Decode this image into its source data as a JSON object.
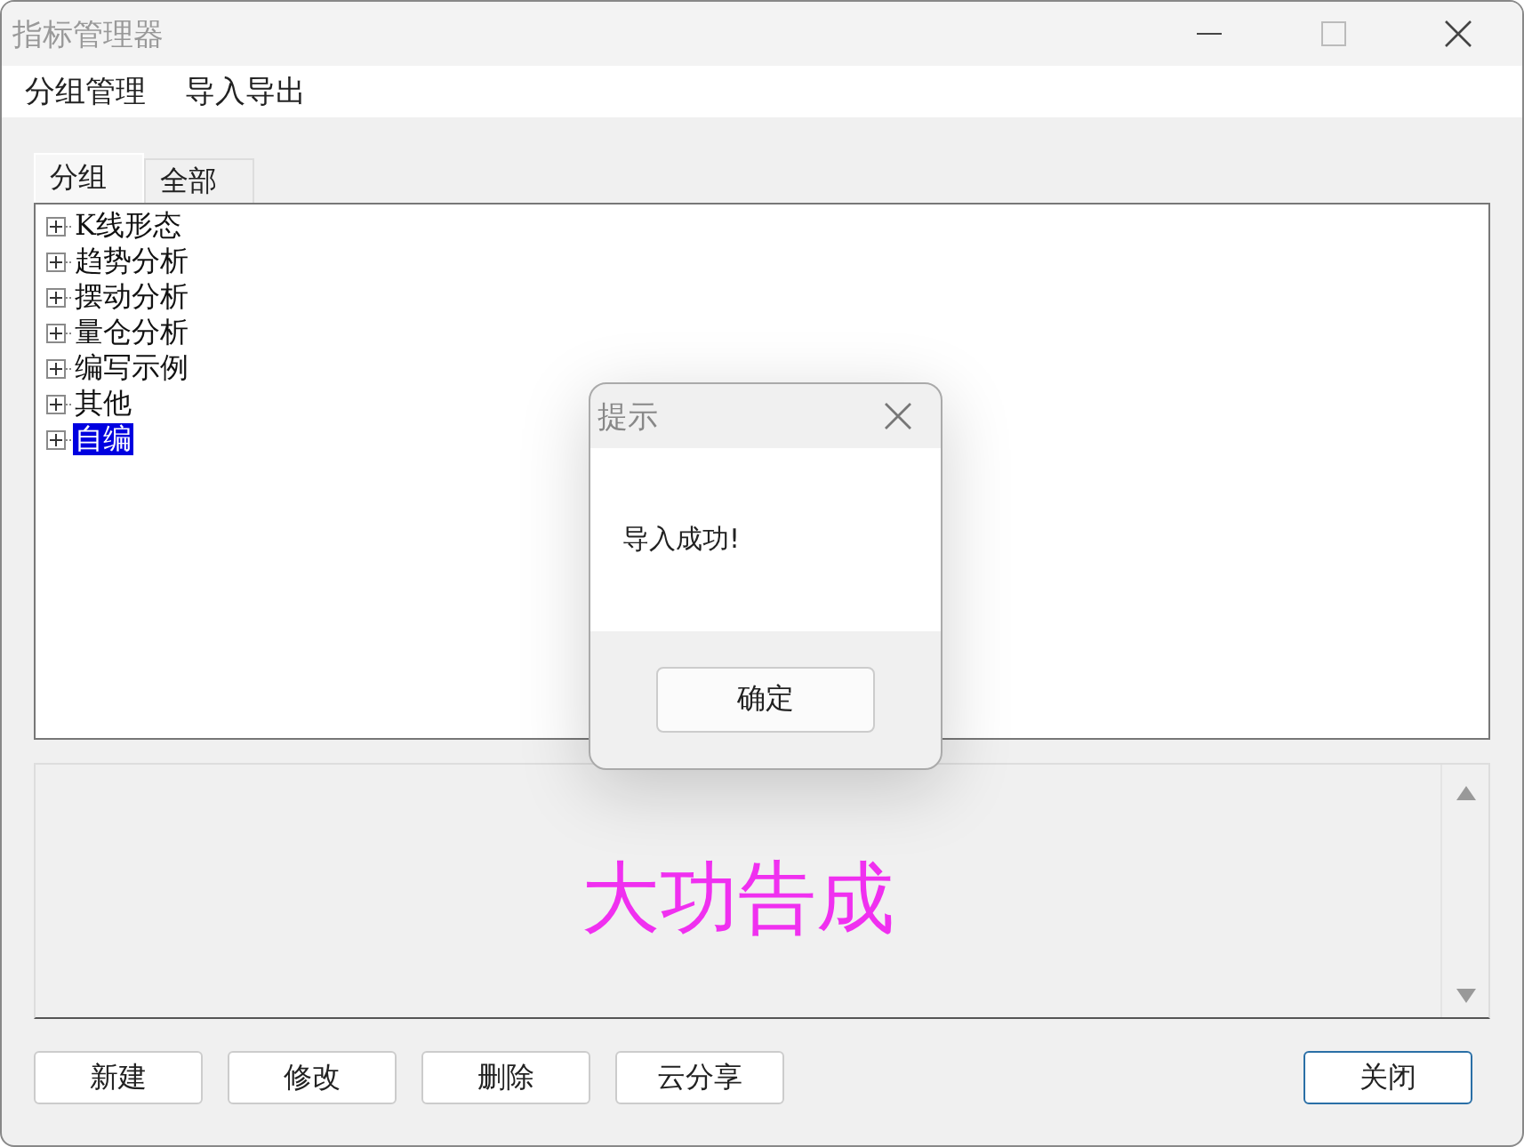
{
  "window": {
    "title": "指标管理器"
  },
  "menu": [
    "分组管理",
    "导入导出"
  ],
  "tabs": [
    {
      "label": "分组",
      "selected": true
    },
    {
      "label": "全部",
      "selected": false
    }
  ],
  "tree": [
    {
      "label": "K线形态",
      "expanded": false,
      "selected": false
    },
    {
      "label": "趋势分析",
      "expanded": false,
      "selected": false
    },
    {
      "label": "摆动分析",
      "expanded": false,
      "selected": false
    },
    {
      "label": "量仓分析",
      "expanded": false,
      "selected": false
    },
    {
      "label": "编写示例",
      "expanded": false,
      "selected": false
    },
    {
      "label": "其他",
      "expanded": false,
      "selected": false
    },
    {
      "label": "自编",
      "expanded": false,
      "selected": true
    }
  ],
  "description": {
    "text": "大功告成"
  },
  "buttons": [
    "新建",
    "修改",
    "删除",
    "云分享"
  ],
  "close_button": "关闭",
  "dialog": {
    "title": "提示",
    "message": "导入成功!",
    "button": "确定"
  }
}
